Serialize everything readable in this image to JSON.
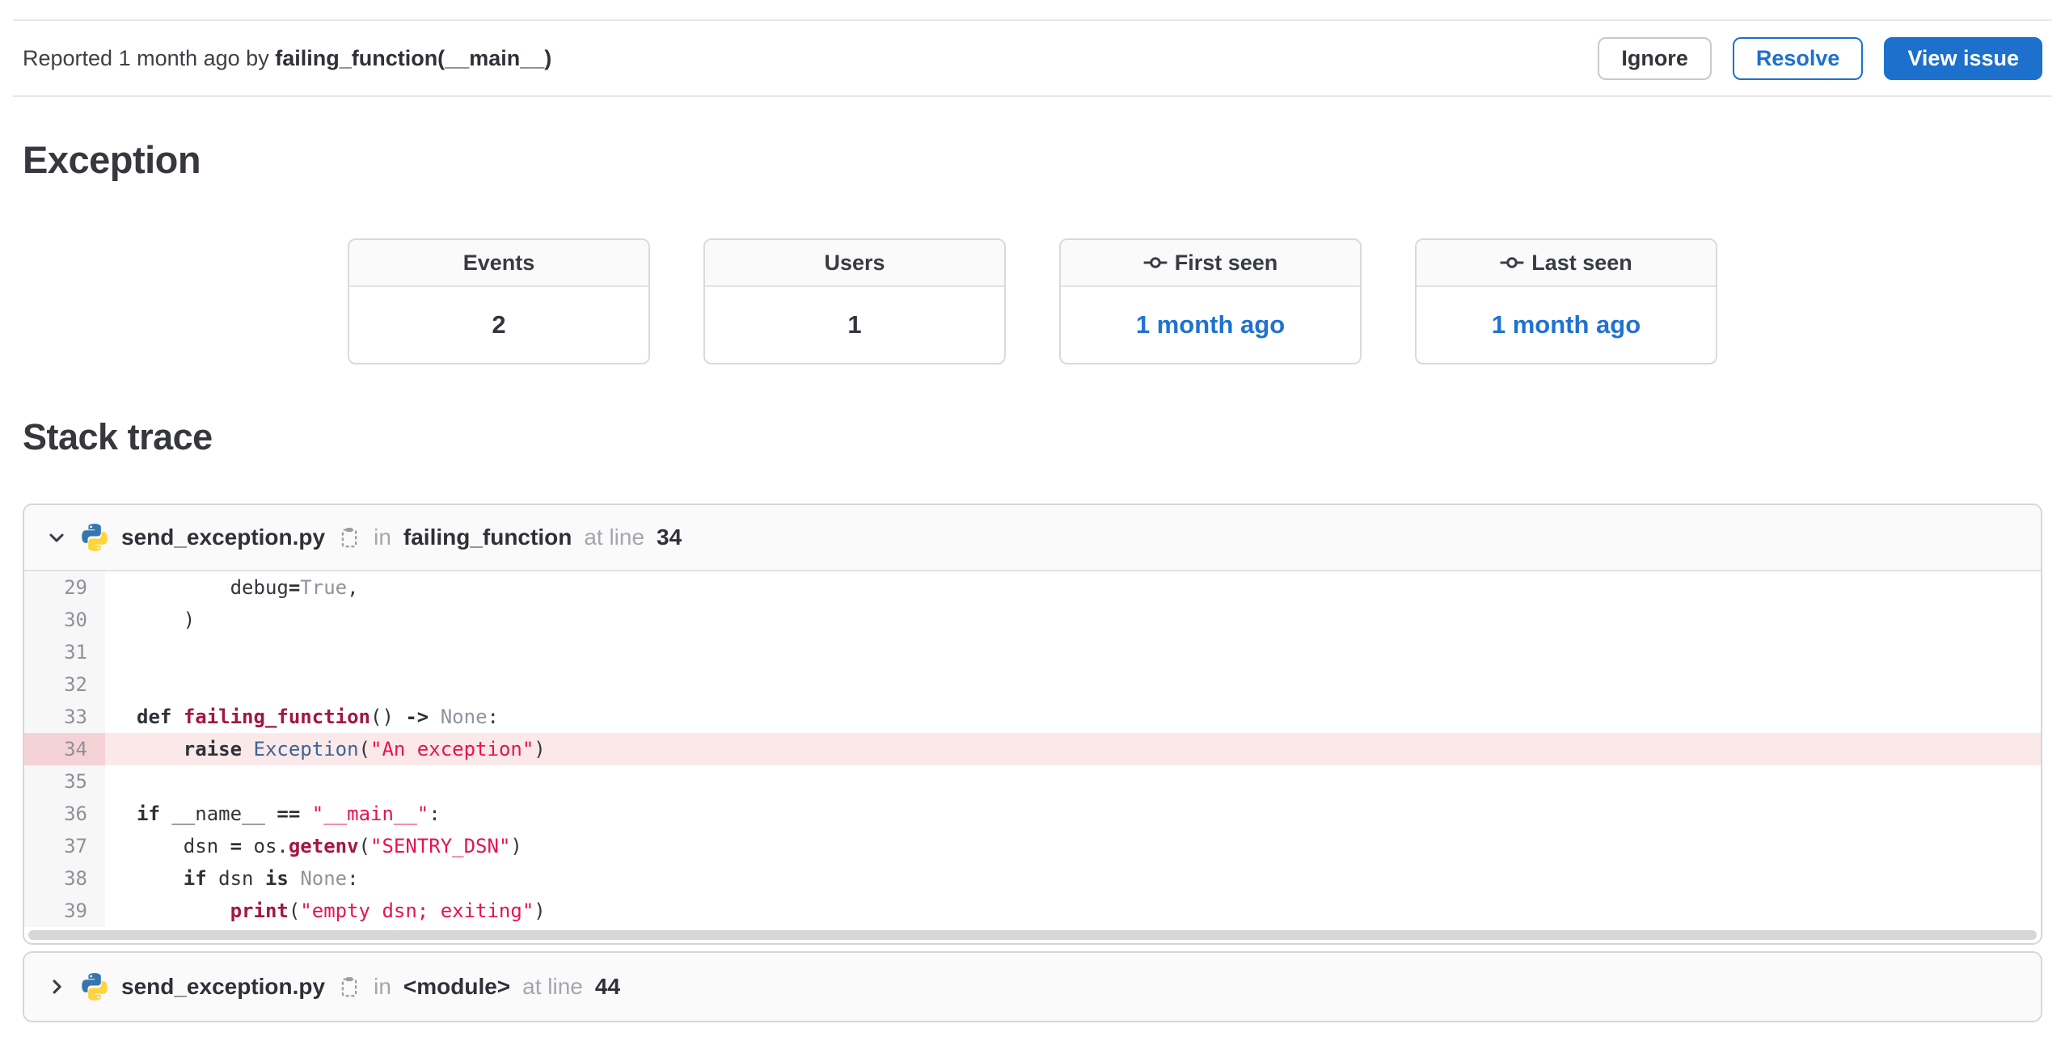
{
  "colors": {
    "accent_blue": "#1d70cc",
    "link_blue": "#1f72cf",
    "string_red": "#e7134e",
    "function_red": "#a31742",
    "class_blue": "#3d6394",
    "highlight_bg": "#fbe9ea",
    "highlight_gutter_bg": "#f5d2d6"
  },
  "header": {
    "reported_prefix": "Reported 1 month ago by ",
    "reported_actor": "failing_function(__main__)",
    "actions": {
      "ignore": "Ignore",
      "resolve": "Resolve",
      "view_issue": "View issue"
    }
  },
  "exception_section": {
    "title": "Exception"
  },
  "stats": {
    "cards": [
      {
        "label": "Events",
        "value": "2",
        "icon": null,
        "is_link": false
      },
      {
        "label": "Users",
        "value": "1",
        "icon": null,
        "is_link": false
      },
      {
        "label": "First seen",
        "value": "1 month ago",
        "icon": "commit-icon",
        "is_link": true
      },
      {
        "label": "Last seen",
        "value": "1 month ago",
        "icon": "commit-icon",
        "is_link": true
      }
    ]
  },
  "stack_trace": {
    "title": "Stack trace",
    "frames": [
      {
        "file": "send_exception.py",
        "in_label": "in",
        "function": "failing_function",
        "at_label": "at line",
        "line": "34",
        "expanded": true
      },
      {
        "file": "send_exception.py",
        "in_label": "in",
        "function": "<module>",
        "at_label": "at line",
        "line": "44",
        "expanded": false
      }
    ],
    "code": {
      "highlight_line": 34,
      "lines": [
        {
          "no": 29,
          "tokens": [
            [
              "plain",
              "        debug"
            ],
            [
              "keyword",
              "="
            ],
            [
              "constant",
              "True"
            ],
            [
              "plain",
              ","
            ]
          ]
        },
        {
          "no": 30,
          "tokens": [
            [
              "plain",
              "    )"
            ]
          ]
        },
        {
          "no": 31,
          "tokens": []
        },
        {
          "no": 32,
          "tokens": []
        },
        {
          "no": 33,
          "tokens": [
            [
              "keyword",
              "def"
            ],
            [
              "plain",
              " "
            ],
            [
              "function",
              "failing_function"
            ],
            [
              "plain",
              "() "
            ],
            [
              "keyword",
              "->"
            ],
            [
              "plain",
              " "
            ],
            [
              "constant",
              "None"
            ],
            [
              "plain",
              ":"
            ]
          ]
        },
        {
          "no": 34,
          "tokens": [
            [
              "plain",
              "    "
            ],
            [
              "keyword",
              "raise"
            ],
            [
              "plain",
              " "
            ],
            [
              "class",
              "Exception"
            ],
            [
              "plain",
              "("
            ],
            [
              "string",
              "\"An exception\""
            ],
            [
              "plain",
              ")"
            ]
          ]
        },
        {
          "no": 35,
          "tokens": []
        },
        {
          "no": 36,
          "tokens": [
            [
              "keyword",
              "if"
            ],
            [
              "plain",
              " __name__ "
            ],
            [
              "keyword",
              "=="
            ],
            [
              "plain",
              " "
            ],
            [
              "string",
              "\"__main__\""
            ],
            [
              "plain",
              ":"
            ]
          ]
        },
        {
          "no": 37,
          "tokens": [
            [
              "plain",
              "    dsn "
            ],
            [
              "keyword",
              "="
            ],
            [
              "plain",
              " os."
            ],
            [
              "function",
              "getenv"
            ],
            [
              "plain",
              "("
            ],
            [
              "string",
              "\"SENTRY_DSN\""
            ],
            [
              "plain",
              ")"
            ]
          ]
        },
        {
          "no": 38,
          "tokens": [
            [
              "plain",
              "    "
            ],
            [
              "keyword",
              "if"
            ],
            [
              "plain",
              " dsn "
            ],
            [
              "keyword",
              "is"
            ],
            [
              "plain",
              " "
            ],
            [
              "constant",
              "None"
            ],
            [
              "plain",
              ":"
            ]
          ]
        },
        {
          "no": 39,
          "tokens": [
            [
              "plain",
              "        "
            ],
            [
              "function",
              "print"
            ],
            [
              "plain",
              "("
            ],
            [
              "string",
              "\"empty dsn; exiting\""
            ],
            [
              "plain",
              ")"
            ]
          ]
        }
      ]
    }
  }
}
